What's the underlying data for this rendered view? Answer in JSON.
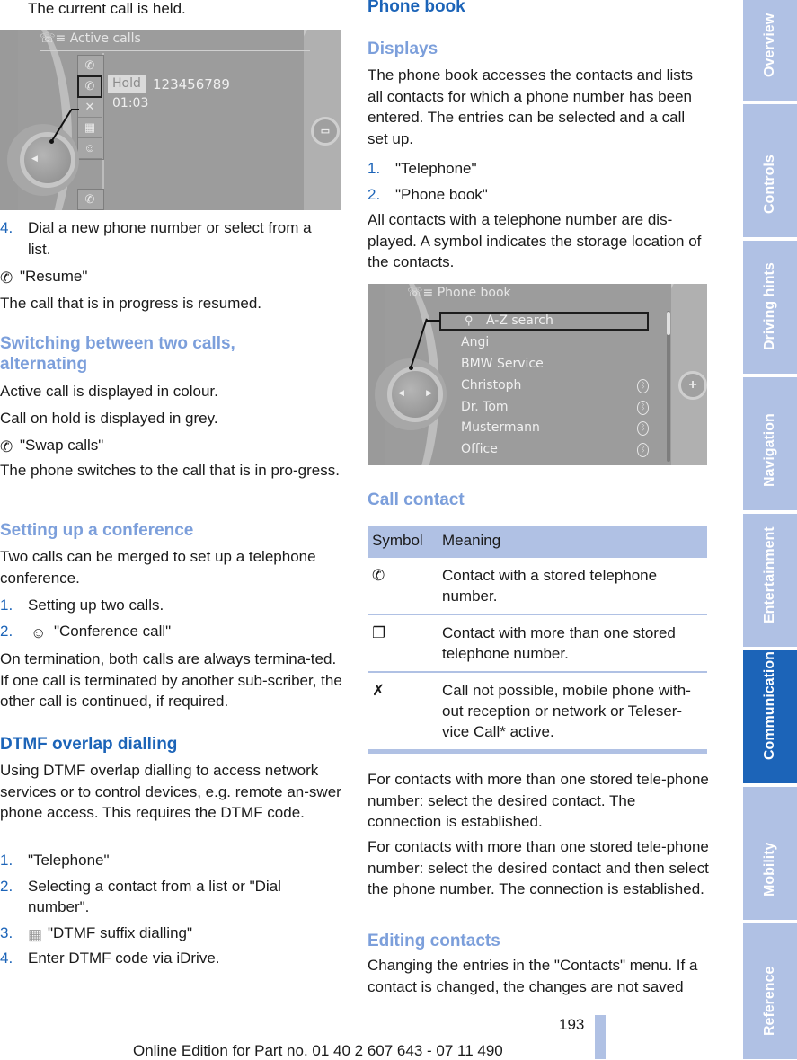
{
  "left": {
    "intro": "The current call is held.",
    "active_calls_screen": {
      "title": "Active calls",
      "hold_label": "Hold",
      "number": "123456789",
      "duration": "01:03",
      "menu_icons": [
        "phone-handset-icon",
        "hold-call-icon",
        "microphone-mute-icon",
        "keypad-icon",
        "conference-icon"
      ],
      "bottom_icon": "swap-calls-icon",
      "side_button_icon": "split-screen-icon"
    },
    "step4": {
      "num": "4.",
      "text": "Dial a new phone number or select from a list."
    },
    "resume": {
      "icon": "resume-call-icon",
      "label": "\"Resume\""
    },
    "resume_desc": "The call that is in progress is resumed.",
    "switching_heading": "Switching between two calls, alternating",
    "active_colour": "Active call is displayed in colour.",
    "hold_grey": "Call on hold is displayed in grey.",
    "swap": {
      "icon": "swap-calls-icon",
      "label": "\"Swap calls\""
    },
    "swap_desc": "The phone switches to the call that is in pro-gress.",
    "conference_heading": "Setting up a conference",
    "conference_desc": "Two calls can be merged to set up a telephone conference.",
    "conference_steps": [
      {
        "num": "1.",
        "text": "Setting up two calls."
      },
      {
        "num": "2.",
        "text": "\"Conference call\"",
        "icon": "conference-icon"
      }
    ],
    "termination": "On termination, both calls are always termina-ted. If one call is terminated by another sub-scriber, the other call is continued, if required.",
    "dtmf_heading": "DTMF overlap dialling",
    "dtmf_desc": "Using DTMF overlap dialling to access network services or to control devices, e.g. remote an-swer phone access. This requires the DTMF code.",
    "dtmf_steps": [
      {
        "num": "1.",
        "text": "\"Telephone\""
      },
      {
        "num": "2.",
        "text": "Selecting a contact from a list or \"Dial number\"."
      },
      {
        "num": "3.",
        "text": "\"DTMF suffix dialling\"",
        "icon": "keypad-icon"
      },
      {
        "num": "4.",
        "text": "Enter DTMF code via iDrive."
      }
    ]
  },
  "right": {
    "phonebook_heading": "Phone book",
    "displays_heading": "Displays",
    "displays_desc": "The phone book accesses the contacts and lists all contacts for which a phone number has been entered. The entries can be selected and a call set up.",
    "steps": [
      {
        "num": "1.",
        "text": "\"Telephone\""
      },
      {
        "num": "2.",
        "text": "\"Phone book\""
      }
    ],
    "all_contacts": "All contacts with a telephone number are dis-played. A symbol indicates the storage location of the contacts.",
    "phonebook_screen": {
      "title": "Phone book",
      "search": "A-Z search",
      "contacts": [
        {
          "name": "Angi",
          "bluetooth": false
        },
        {
          "name": "BMW Service",
          "bluetooth": false
        },
        {
          "name": "Christoph",
          "bluetooth": true
        },
        {
          "name": "Dr. Tom",
          "bluetooth": true
        },
        {
          "name": "Mustermann",
          "bluetooth": true
        },
        {
          "name": "Office",
          "bluetooth": true
        }
      ],
      "side_button_icon": "plus-icon",
      "bluetooth_glyph": "ᛒ"
    },
    "call_contact_heading": "Call contact",
    "table": {
      "headers": [
        "Symbol",
        "Meaning"
      ],
      "rows": [
        {
          "icon": "phone-handset-icon",
          "meaning": "Contact with a stored telephone number."
        },
        {
          "icon": "multiple-numbers-icon",
          "meaning": "Contact with more than one stored telephone number."
        },
        {
          "icon": "call-not-possible-icon",
          "meaning": "Call not possible, mobile phone with-out reception or network or Teleser-vice Call* active."
        }
      ]
    },
    "para1": "For contacts with more than one stored tele-phone number: select the desired contact. The connection is established.",
    "para2": "For contacts with more than one stored tele-phone number: select the desired contact and then select the phone number. The connection is established.",
    "editing_heading": "Editing contacts",
    "editing_desc": "Changing the entries in the \"Contacts\" menu. If a contact is changed, the changes are not saved"
  },
  "tabs": [
    {
      "label": "Overview",
      "active": false
    },
    {
      "label": "Controls",
      "active": false
    },
    {
      "label": "Driving hints",
      "active": false
    },
    {
      "label": "Navigation",
      "active": false
    },
    {
      "label": "Entertainment",
      "active": false
    },
    {
      "label": "Communication",
      "active": true
    },
    {
      "label": "Mobility",
      "active": false
    },
    {
      "label": "Reference",
      "active": false
    }
  ],
  "footer": {
    "page_number": "193",
    "edition": "Online Edition for Part no. 01 40 2 607 643 - 07 11 490"
  },
  "colors": {
    "heading_dark": "#1c64b8",
    "heading_light": "#7c9fdb",
    "tab_bg": "#b0c1e4",
    "tab_active": "#1c64b8"
  }
}
